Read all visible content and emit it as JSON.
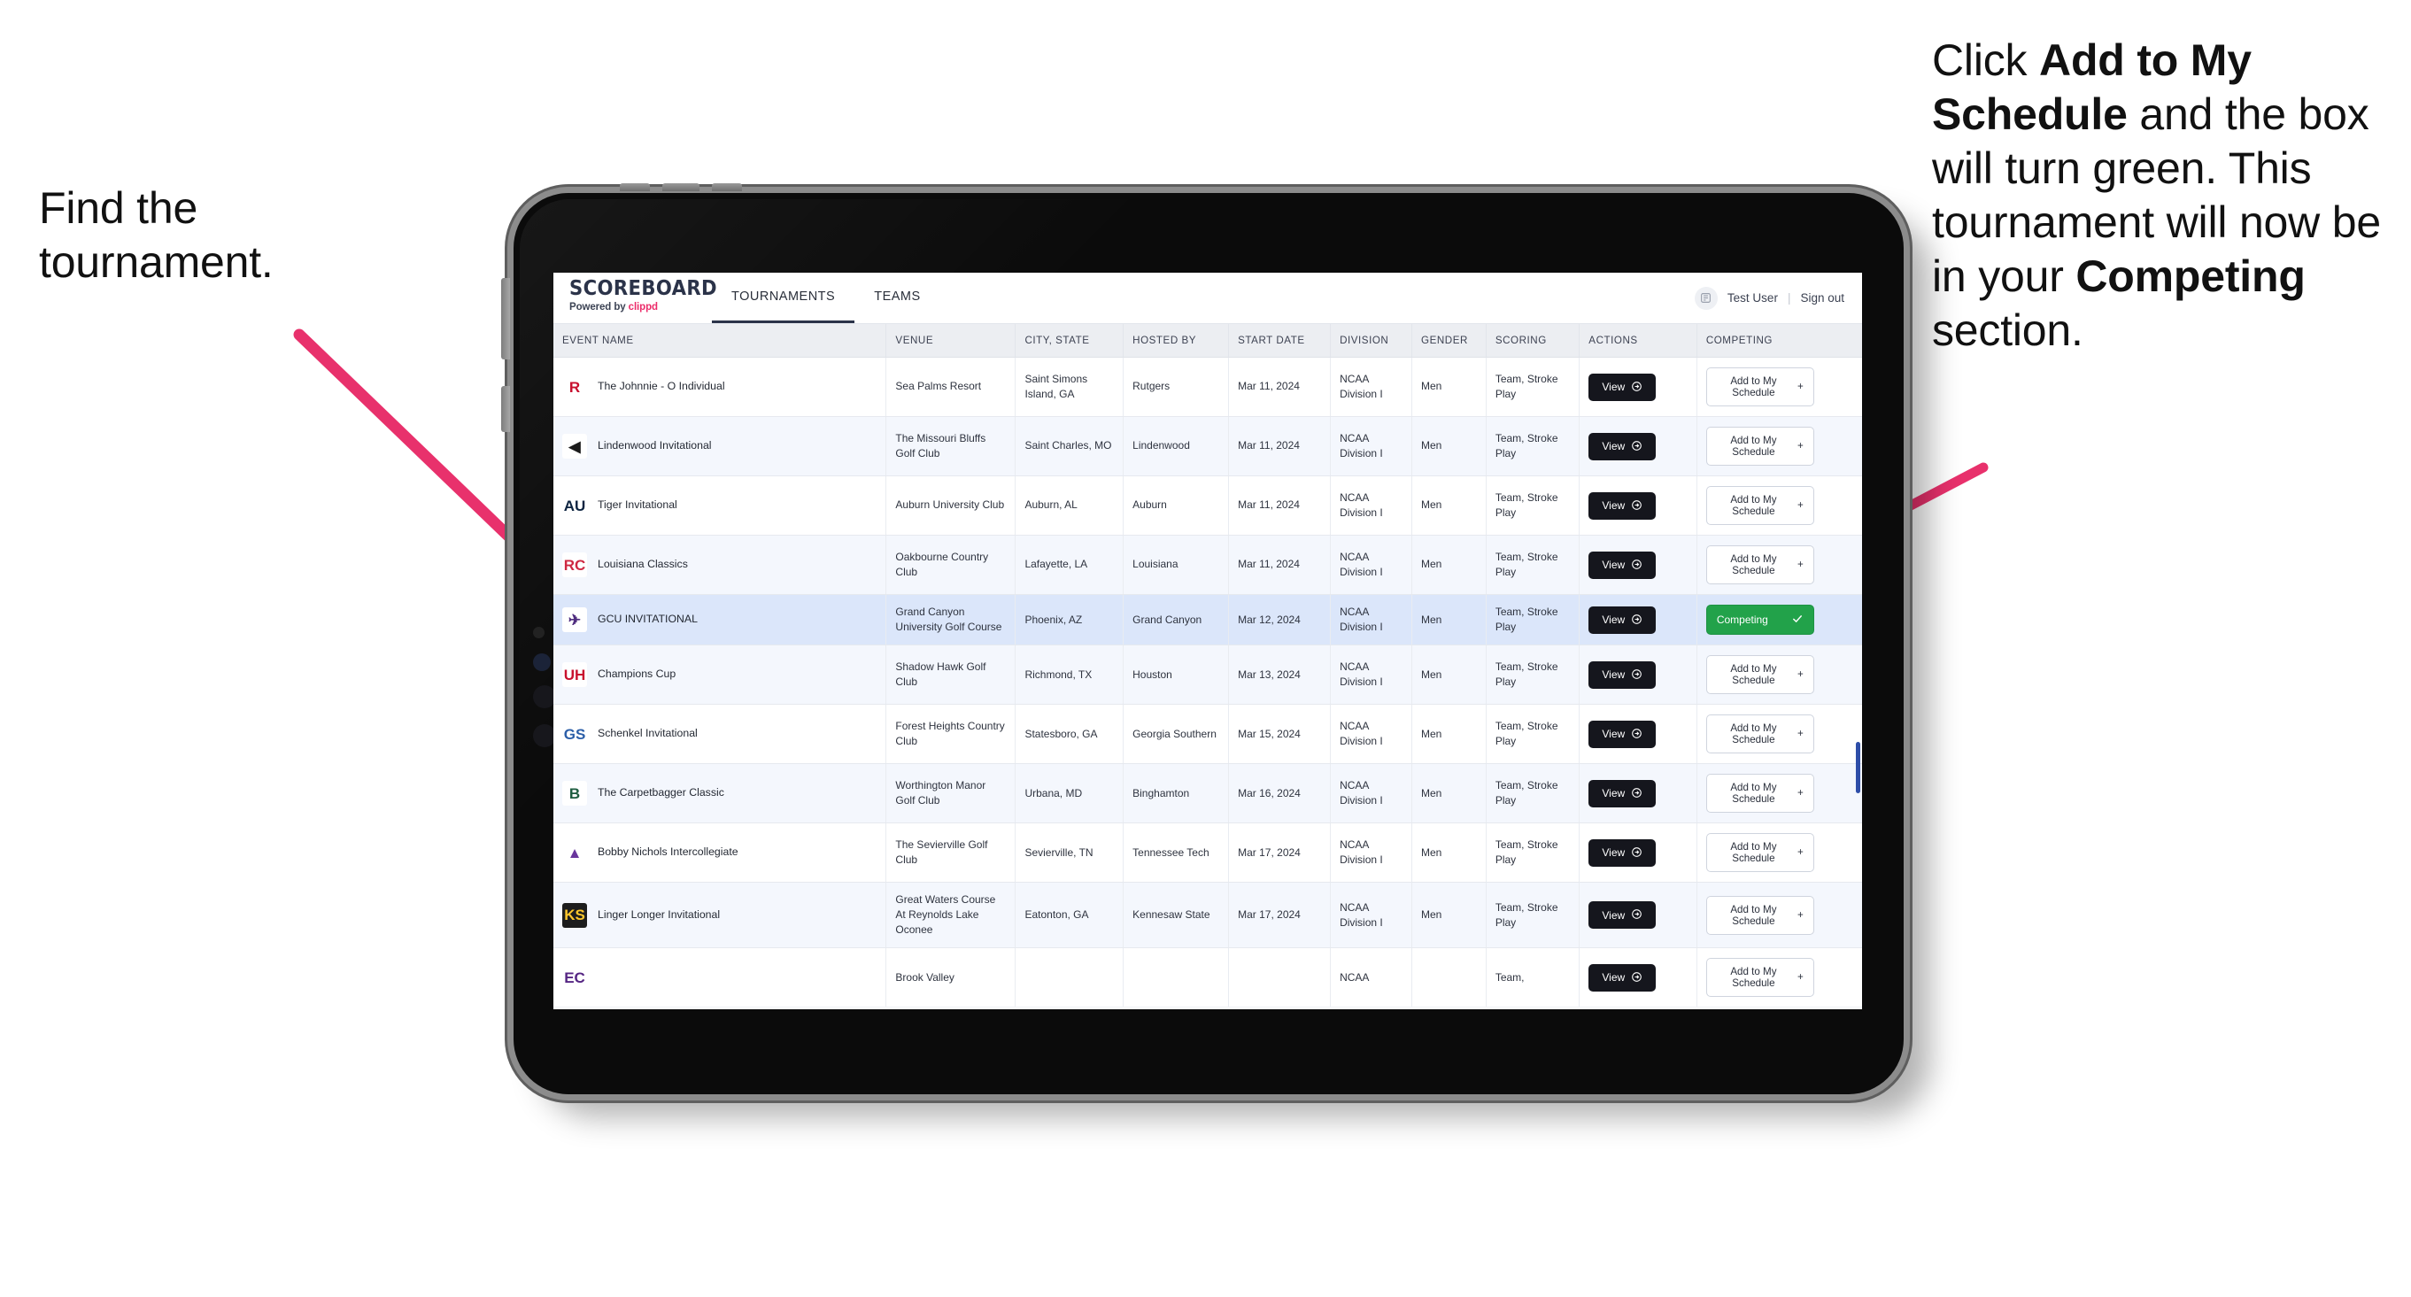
{
  "callouts": {
    "left": {
      "lines": [
        "Find the",
        "tournament."
      ]
    },
    "right": {
      "segments": [
        {
          "text": "Click ",
          "bold": false
        },
        {
          "text": "Add to My Schedule",
          "bold": true
        },
        {
          "text": " and the box will turn green. This tournament will now be in your ",
          "bold": false
        },
        {
          "text": "Competing",
          "bold": true
        },
        {
          "text": " section.",
          "bold": false
        }
      ]
    }
  },
  "colors": {
    "arrow": "#e8316c",
    "competing_green": "#22a24a",
    "brand_navy": "#2b3349",
    "brand_pink": "#ec2c6a",
    "selected_row": "#dbe6fa",
    "view_button": "#15161d"
  },
  "app": {
    "brand": {
      "title": "SCOREBOARD",
      "powered_prefix": "Powered by ",
      "powered_brand": "clippd"
    },
    "tabs": [
      {
        "label": "TOURNAMENTS",
        "active": true
      },
      {
        "label": "TEAMS",
        "active": false
      }
    ],
    "header_right": {
      "avatar_icon": "user-avatar-icon",
      "user_name": "Test User",
      "separator": "|",
      "sign_out": "Sign out"
    },
    "table": {
      "columns": [
        "EVENT NAME",
        "VENUE",
        "CITY, STATE",
        "HOSTED BY",
        "START DATE",
        "DIVISION",
        "GENDER",
        "SCORING",
        "ACTIONS",
        "COMPETING"
      ],
      "view_label": "View",
      "add_label": "Add to My Schedule",
      "add_icon": "plus-icon",
      "competing_label": "Competing",
      "competing_icon": "check-icon",
      "view_icon": "arrow-circle-right-icon",
      "rows": [
        {
          "logo_text": "R",
          "logo_color": "#c8102e",
          "logo_bg": "#ffffff",
          "event": "The Johnnie - O Individual",
          "venue": "Sea Palms Resort",
          "city": "Saint Simons Island, GA",
          "host": "Rutgers",
          "date": "Mar 11, 2024",
          "division": "NCAA Division I",
          "gender": "Men",
          "scoring": "Team, Stroke Play",
          "competing": false
        },
        {
          "logo_text": "◀",
          "logo_color": "#1b1b1b",
          "logo_bg": "#ffffff",
          "event": "Lindenwood Invitational",
          "venue": "The Missouri Bluffs Golf Club",
          "city": "Saint Charles, MO",
          "host": "Lindenwood",
          "date": "Mar 11, 2024",
          "division": "NCAA Division I",
          "gender": "Men",
          "scoring": "Team, Stroke Play",
          "competing": false
        },
        {
          "logo_text": "AU",
          "logo_color": "#0c2340",
          "logo_bg": "#ffffff",
          "event": "Tiger Invitational",
          "venue": "Auburn University Club",
          "city": "Auburn, AL",
          "host": "Auburn",
          "date": "Mar 11, 2024",
          "division": "NCAA Division I",
          "gender": "Men",
          "scoring": "Team, Stroke Play",
          "competing": false
        },
        {
          "logo_text": "RC",
          "logo_color": "#ce2842",
          "logo_bg": "#ffffff",
          "event": "Louisiana Classics",
          "venue": "Oakbourne Country Club",
          "city": "Lafayette, LA",
          "host": "Louisiana",
          "date": "Mar 11, 2024",
          "division": "NCAA Division I",
          "gender": "Men",
          "scoring": "Team, Stroke Play",
          "competing": false
        },
        {
          "logo_text": "✈",
          "logo_color": "#4f2d7f",
          "logo_bg": "#ffffff",
          "event": "GCU INVITATIONAL",
          "venue": "Grand Canyon University Golf Course",
          "city": "Phoenix, AZ",
          "host": "Grand Canyon",
          "date": "Mar 12, 2024",
          "division": "NCAA Division I",
          "gender": "Men",
          "scoring": "Team, Stroke Play",
          "competing": true
        },
        {
          "logo_text": "UH",
          "logo_color": "#c8102e",
          "logo_bg": "#ffffff",
          "event": "Champions Cup",
          "venue": "Shadow Hawk Golf Club",
          "city": "Richmond, TX",
          "host": "Houston",
          "date": "Mar 13, 2024",
          "division": "NCAA Division I",
          "gender": "Men",
          "scoring": "Team, Stroke Play",
          "competing": false
        },
        {
          "logo_text": "GS",
          "logo_color": "#2b5ea8",
          "logo_bg": "#ffffff",
          "event": "Schenkel Invitational",
          "venue": "Forest Heights Country Club",
          "city": "Statesboro, GA",
          "host": "Georgia Southern",
          "date": "Mar 15, 2024",
          "division": "NCAA Division I",
          "gender": "Men",
          "scoring": "Team, Stroke Play",
          "competing": false
        },
        {
          "logo_text": "B",
          "logo_color": "#1d5c3f",
          "logo_bg": "#ffffff",
          "event": "The Carpetbagger Classic",
          "venue": "Worthington Manor Golf Club",
          "city": "Urbana, MD",
          "host": "Binghamton",
          "date": "Mar 16, 2024",
          "division": "NCAA Division I",
          "gender": "Men",
          "scoring": "Team, Stroke Play",
          "competing": false
        },
        {
          "logo_text": "▲",
          "logo_color": "#69359c",
          "logo_bg": "#ffffff",
          "event": "Bobby Nichols Intercollegiate",
          "venue": "The Sevierville Golf Club",
          "city": "Sevierville, TN",
          "host": "Tennessee Tech",
          "date": "Mar 17, 2024",
          "division": "NCAA Division I",
          "gender": "Men",
          "scoring": "Team, Stroke Play",
          "competing": false
        },
        {
          "logo_text": "KS",
          "logo_color": "#ffc72c",
          "logo_bg": "#1d1d1d",
          "event": "Linger Longer Invitational",
          "venue": "Great Waters Course At Reynolds Lake Oconee",
          "city": "Eatonton, GA",
          "host": "Kennesaw State",
          "date": "Mar 17, 2024",
          "division": "NCAA Division I",
          "gender": "Men",
          "scoring": "Team, Stroke Play",
          "competing": false
        },
        {
          "logo_text": "EC",
          "logo_color": "#552583",
          "logo_bg": "#ffffff",
          "event": "",
          "venue": "Brook Valley",
          "city": "",
          "host": "",
          "date": "",
          "division": "NCAA",
          "gender": "",
          "scoring": "Team,",
          "competing": false
        }
      ]
    }
  }
}
